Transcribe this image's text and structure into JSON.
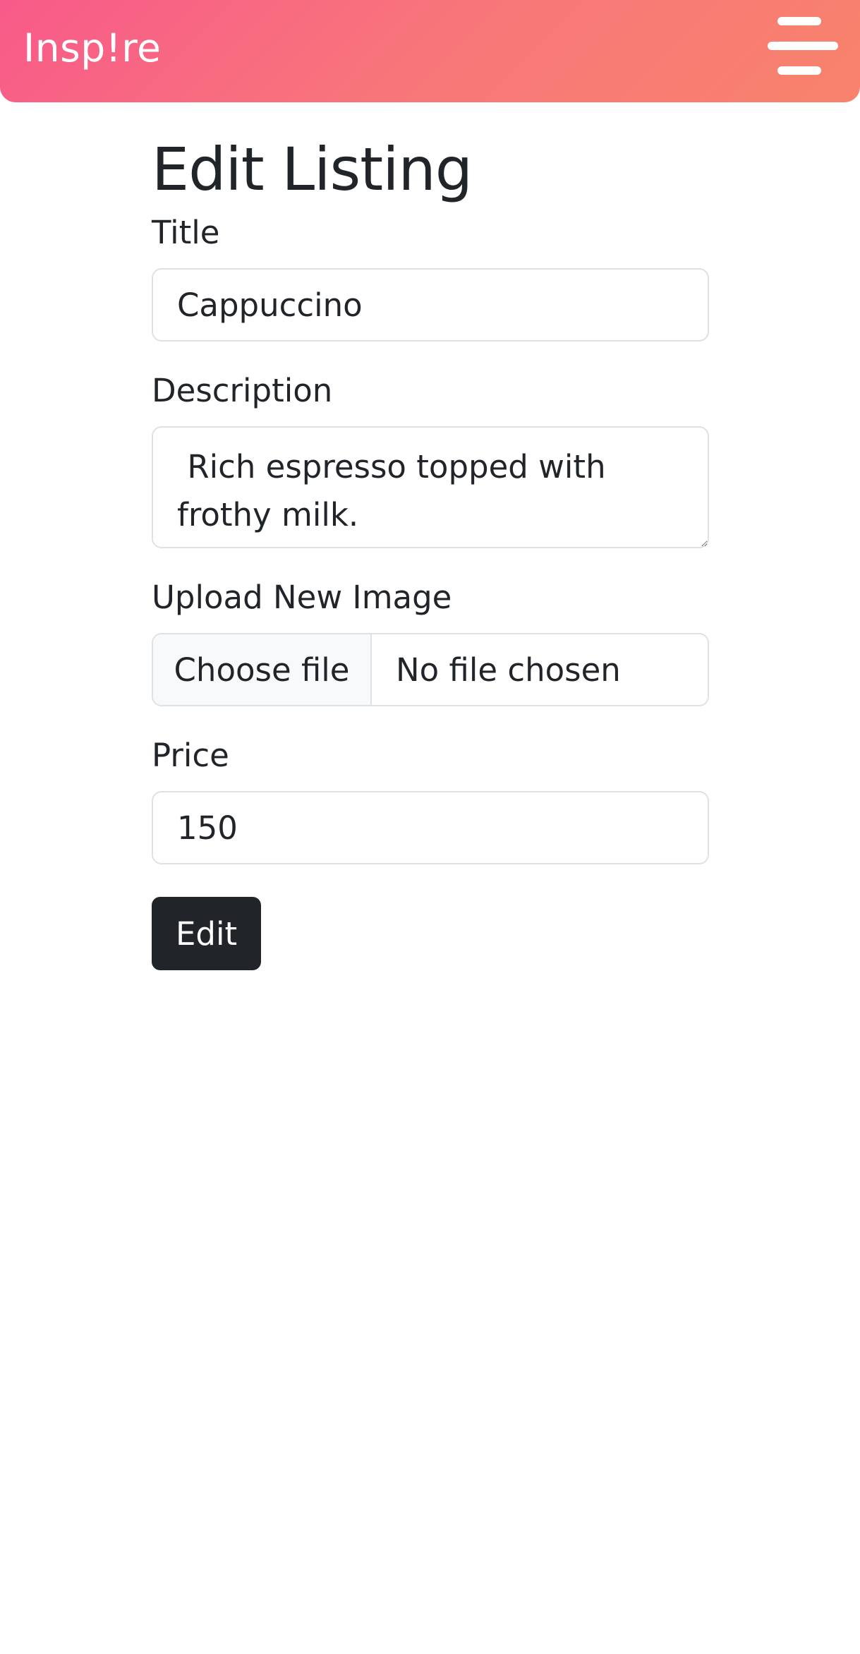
{
  "navbar": {
    "brand": "Insp!re",
    "menu_icon": "hamburger-menu-icon"
  },
  "page": {
    "title": "Edit Listing"
  },
  "form": {
    "title_label": "Title",
    "title_value": "Cappuccino",
    "description_label": "Description",
    "description_value": " Rich espresso topped with frothy milk.",
    "image_label": "Upload New Image",
    "file_button_label": "Choose file",
    "file_status": "No file chosen",
    "price_label": "Price",
    "price_value": "150",
    "submit_label": "Edit"
  },
  "colors": {
    "navbar_gradient_start": "#f85a8a",
    "navbar_gradient_end": "#f8836c",
    "button_bg": "#212529"
  }
}
